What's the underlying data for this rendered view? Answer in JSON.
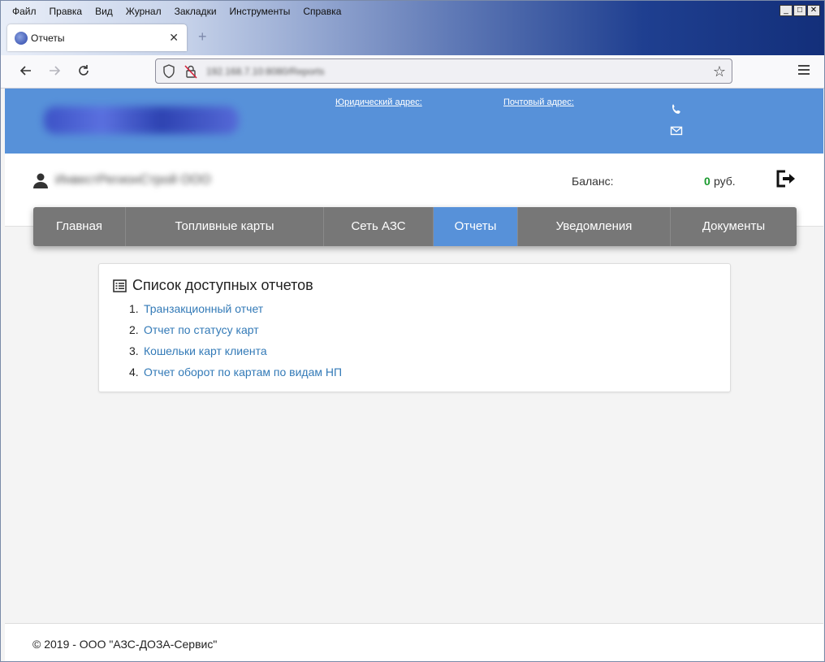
{
  "browser": {
    "menu": [
      "Файл",
      "Правка",
      "Вид",
      "Журнал",
      "Закладки",
      "Инструменты",
      "Справка"
    ],
    "tab": {
      "title": "Отчеты",
      "close": "✕"
    },
    "new_tab": "+",
    "url": "192.168.7.10:8080/Reports",
    "window_controls": {
      "minimize": "_",
      "maximize": "□",
      "close": "✕"
    }
  },
  "header": {
    "legal_address_label": "Юридический адрес:",
    "postal_address_label": "Почтовый адрес:"
  },
  "user": {
    "name": "ИнвестРегионСтрой ООО",
    "balance_label": "Баланс:",
    "balance_value": "0",
    "balance_unit": "руб."
  },
  "nav": {
    "items": [
      {
        "label": "Главная",
        "active": false
      },
      {
        "label": "Топливные карты",
        "active": false
      },
      {
        "label": "Сеть АЗС",
        "active": false
      },
      {
        "label": "Отчеты",
        "active": true
      },
      {
        "label": "Уведомления",
        "active": false
      },
      {
        "label": "Документы",
        "active": false
      }
    ]
  },
  "panel": {
    "title": "Список доступных отчетов",
    "reports": [
      {
        "num": "1.",
        "label": "Транзакционный отчет"
      },
      {
        "num": "2.",
        "label": "Отчет по статусу карт"
      },
      {
        "num": "3.",
        "label": "Кошельки карт клиента"
      },
      {
        "num": "4.",
        "label": "Отчет оборот по картам по видам НП"
      }
    ]
  },
  "footer": {
    "text": "© 2019 - ООО \"АЗС-ДОЗА-Сервис\""
  },
  "colors": {
    "header_bg": "#5791d9",
    "nav_bg": "#777777",
    "nav_active": "#5791d9",
    "link": "#337ab7",
    "balance_value": "#1a9a2e"
  }
}
